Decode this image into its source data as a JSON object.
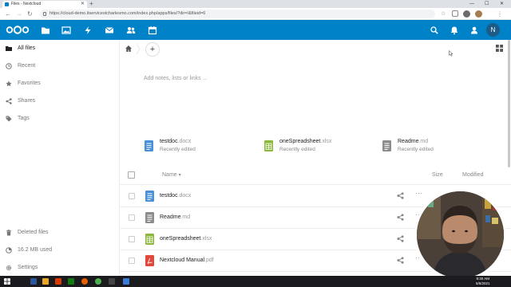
{
  "browser": {
    "tab_title": "Files - Nextcloud",
    "new_tab": "+",
    "url": "https://cloud-demo.itservicestcharlesmo.com/index.php/apps/files/?dir=/&fileid=6",
    "controls": {
      "minimize": "—",
      "maximize": "☐",
      "close": "✕"
    }
  },
  "header": {
    "avatar_initial": "N",
    "apps": [
      "files-icon",
      "photos-icon",
      "activity-icon",
      "mail-icon",
      "contacts-icon",
      "calendar-icon"
    ]
  },
  "sidebar": {
    "items": [
      {
        "label": "All files",
        "icon": "folder-icon",
        "active": true
      },
      {
        "label": "Recent",
        "icon": "clock-icon"
      },
      {
        "label": "Favorites",
        "icon": "star-icon"
      },
      {
        "label": "Shares",
        "icon": "share-icon"
      },
      {
        "label": "Tags",
        "icon": "tag-icon"
      }
    ],
    "bottom": {
      "deleted": "Deleted files",
      "quota": "16.2 MB used",
      "settings": "Settings"
    }
  },
  "main": {
    "new_button": "+",
    "notes_placeholder": "Add notes, lists or links ...",
    "recent": [
      {
        "name": "testdoc",
        "ext": ".docx",
        "sub": "Recently edited",
        "color": "#4a90d9"
      },
      {
        "name": "oneSpreadsheet",
        "ext": ".xlsx",
        "sub": "Recently edited",
        "color": "#8bb83b"
      },
      {
        "name": "Readme",
        "ext": ".md",
        "sub": "Recently edited",
        "color": "#8c8c8c"
      }
    ],
    "columns": {
      "name": "Name",
      "sort_indicator": "▾",
      "size": "Size",
      "modified": "Modified"
    },
    "files": [
      {
        "name": "testdoc",
        "ext": ".docx",
        "color": "#4a90d9"
      },
      {
        "name": "Readme",
        "ext": ".md",
        "color": "#8c8c8c"
      },
      {
        "name": "oneSpreadsheet",
        "ext": ".xlsx",
        "color": "#8bb83b"
      },
      {
        "name": "Nextcloud Manual",
        "ext": ".pdf",
        "color": "#e2473b"
      }
    ],
    "more_label": "···"
  },
  "taskbar": {
    "time": "9:30 AM",
    "date": "5/5/2021"
  },
  "colors": {
    "header_blue": "#0082c9",
    "avatar": "#1c5c86"
  }
}
